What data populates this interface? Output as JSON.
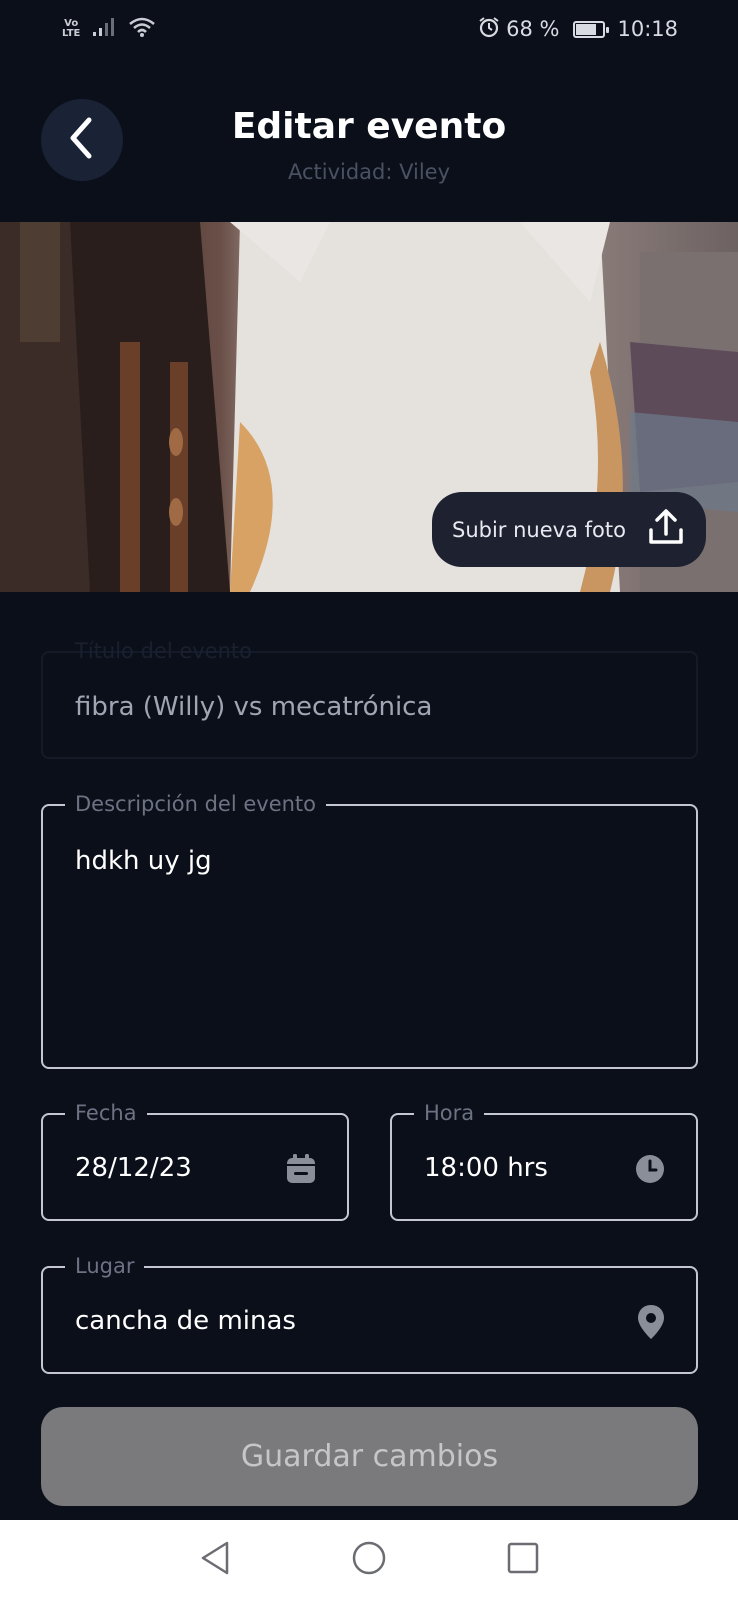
{
  "status_bar": {
    "network_top": "Vo",
    "network_bottom": "LTE",
    "battery_text": "68 %",
    "battery_level": 0.68,
    "time": "10:18"
  },
  "header": {
    "title": "Editar evento",
    "subtitle": "Actividad: Viley"
  },
  "photo": {
    "upload_label": "Subir nueva foto"
  },
  "form": {
    "title_label": "Título del evento",
    "title_value": "fibra (Willy) vs mecatrónica",
    "description_label": "Descripción del evento",
    "description_value": "hdkh uy jg",
    "date_label": "Fecha",
    "date_value": "28/12/23",
    "time_label": "Hora",
    "time_value": "18:00 hrs",
    "place_label": "Lugar",
    "place_value": "cancha de minas"
  },
  "actions": {
    "save_label": "Guardar cambios"
  },
  "colors": {
    "background": "#0b0f19",
    "field_border": "#c4c7cf",
    "label": "#6c7283",
    "save_button_bg": "#7a7a7c",
    "upload_button_bg": "#1d2130"
  }
}
